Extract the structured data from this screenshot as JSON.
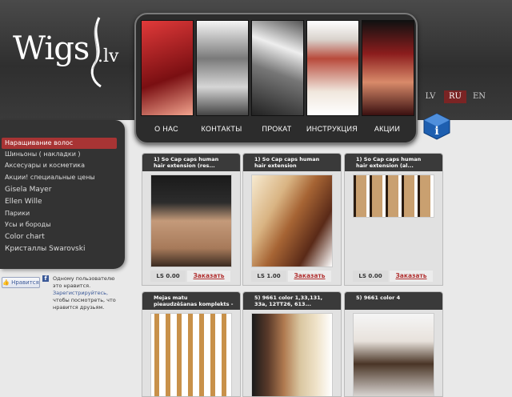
{
  "brand": {
    "name": "Wigs",
    "tld": ".lv"
  },
  "nav": [
    {
      "label": "О НАС"
    },
    {
      "label": "КОНТАКТЫ"
    },
    {
      "label": "ПРОКАТ"
    },
    {
      "label": "ИНСТРУКЦИЯ"
    },
    {
      "label": "АКЦИИ"
    }
  ],
  "languages": [
    {
      "label": "LV",
      "active": false
    },
    {
      "label": "RU",
      "active": true
    },
    {
      "label": "EN",
      "active": false
    }
  ],
  "sidebar": {
    "items": [
      {
        "label": "Наращивание волос",
        "active": true
      },
      {
        "label": "Шиньоны ( накладки )"
      },
      {
        "label": "Аксесуары и косметика"
      },
      {
        "label": "Акции! специальные цены"
      },
      {
        "label": "Gisela Mayer"
      },
      {
        "label": "Ellen Wille"
      },
      {
        "label": "Парики"
      },
      {
        "label": "Усы и бороды"
      },
      {
        "label": "Color chart"
      },
      {
        "label": "Кристаллы Swarovski"
      }
    ]
  },
  "facebook": {
    "like_label": "Нравится",
    "line1": "Одному пользователю",
    "line2": "это нравится.",
    "link": "Зарегистрируйтесь,",
    "line3": "чтобы посмотреть, что",
    "line4": "нравится друзьям."
  },
  "products": [
    {
      "title_l1": "1) So Cap caps human",
      "title_l2": "hair extension (res...",
      "price": "LS 0.00",
      "order": "Заказать"
    },
    {
      "title_l1": "1) So Cap caps human",
      "title_l2": "hair extension",
      "price": "LS 1.00",
      "order": "Заказать"
    },
    {
      "title_l1": "1) So Cap caps human",
      "title_l2": "hair extension (al...",
      "price": "LS 0.00",
      "order": "Заказать"
    },
    {
      "title_l1": "Matu",
      "title_l2": "pieaudzēšanas komplekts -",
      "title_l3": "Mejas matu"
    },
    {
      "title_l1": "5) 9661 color 1,33,131,",
      "title_l2": "33a, 12TT26, 613..."
    },
    {
      "title_l1": "5) 9661 color 4",
      "title_l2": ""
    }
  ],
  "colors": {
    "accent": "#a83434",
    "header_bg": "#3a3a3a"
  }
}
